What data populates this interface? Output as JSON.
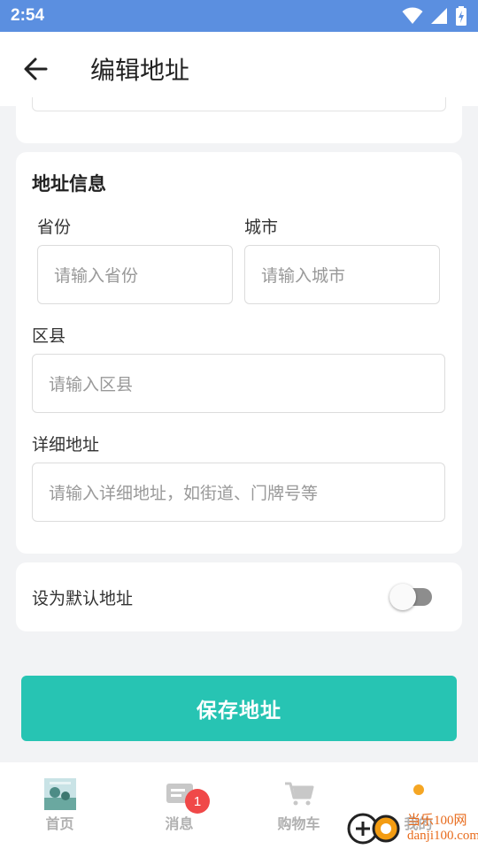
{
  "status_bar": {
    "time": "2:54"
  },
  "app_bar": {
    "title": "编辑地址"
  },
  "address_card": {
    "title": "地址信息",
    "province": {
      "label": "省份",
      "placeholder": "请输入省份"
    },
    "city": {
      "label": "城市",
      "placeholder": "请输入城市"
    },
    "district": {
      "label": "区县",
      "placeholder": "请输入区县"
    },
    "detail": {
      "label": "详细地址",
      "placeholder": "请输入详细地址，如街道、门牌号等"
    }
  },
  "default_card": {
    "label": "设为默认地址",
    "checked": false
  },
  "save_button": {
    "label": "保存地址"
  },
  "tab_bar": {
    "tabs": [
      {
        "label": "首页"
      },
      {
        "label": "消息",
        "badge": "1"
      },
      {
        "label": "购物车"
      },
      {
        "label": "我的"
      }
    ]
  },
  "watermark": {
    "site": "danji100.com",
    "brand": "当乐100网"
  },
  "colors": {
    "status_bar": "#5b8fe0",
    "accent": "#27c4b3",
    "badge": "#f04848",
    "background": "#f2f3f5"
  }
}
